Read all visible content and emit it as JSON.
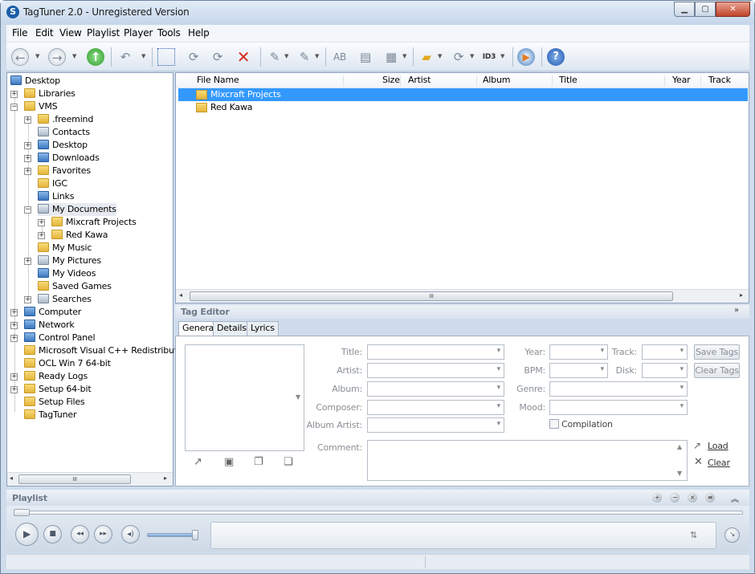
{
  "window": {
    "title": "TagTuner 2.0 - Unregistered Version",
    "app_icon": "S"
  },
  "menu": [
    "File",
    "Edit",
    "View",
    "Playlist",
    "Player",
    "Tools",
    "Help"
  ],
  "tree": [
    {
      "label": "Desktop",
      "icon": "desktop-icon"
    },
    {
      "label": "Libraries",
      "icon": "libraries-icon"
    },
    {
      "label": "VMS",
      "icon": "user-folder-icon"
    },
    {
      "label": ".freemind",
      "icon": "folder-icon"
    },
    {
      "label": "Contacts",
      "icon": "contacts-icon"
    },
    {
      "label": "Desktop",
      "icon": "desktop-folder-icon"
    },
    {
      "label": "Downloads",
      "icon": "downloads-icon"
    },
    {
      "label": "Favorites",
      "icon": "favorites-icon"
    },
    {
      "label": "IGC",
      "icon": "folder-icon"
    },
    {
      "label": "Links",
      "icon": "links-icon"
    },
    {
      "label": "My Documents",
      "icon": "documents-icon"
    },
    {
      "label": "Mixcraft Projects",
      "icon": "folder-icon"
    },
    {
      "label": "Red Kawa",
      "icon": "folder-icon"
    },
    {
      "label": "My Music",
      "icon": "music-icon"
    },
    {
      "label": "My Pictures",
      "icon": "pictures-icon"
    },
    {
      "label": "My Videos",
      "icon": "videos-icon"
    },
    {
      "label": "Saved Games",
      "icon": "saved-games-icon"
    },
    {
      "label": "Searches",
      "icon": "searches-icon"
    },
    {
      "label": "Computer",
      "icon": "computer-icon"
    },
    {
      "label": "Network",
      "icon": "network-icon"
    },
    {
      "label": "Control Panel",
      "icon": "control-panel-icon"
    },
    {
      "label": "Microsoft Visual C++ Redistributable",
      "icon": "folder-icon"
    },
    {
      "label": "OCL Win 7 64-bit",
      "icon": "folder-icon"
    },
    {
      "label": "Ready Logs",
      "icon": "folder-icon"
    },
    {
      "label": "Setup 64-bit",
      "icon": "folder-icon"
    },
    {
      "label": "Setup Files",
      "icon": "folder-icon"
    },
    {
      "label": "TagTuner",
      "icon": "folder-icon"
    }
  ],
  "file_list": {
    "columns": [
      "File Name",
      "Size",
      "Artist",
      "Album",
      "Title",
      "Year",
      "Track"
    ],
    "rows": [
      {
        "name": "Mixcraft Projects",
        "selected": true
      },
      {
        "name": "Red Kawa",
        "selected": false
      }
    ],
    "selection_color": "#3399ff"
  },
  "scroll_grip": "III",
  "tag_editor": {
    "title": "Tag Editor",
    "tabs": [
      "General",
      "Details",
      "Lyrics"
    ],
    "active_tab": "General",
    "labels": {
      "title": "Title:",
      "artist": "Artist:",
      "album": "Album:",
      "composer": "Composer:",
      "album_artist": "Album Artist:",
      "comment": "Comment:",
      "year": "Year:",
      "bpm": "BPM:",
      "genre": "Genre:",
      "mood": "Mood:",
      "track": "Track:",
      "disk": "Disk:"
    },
    "compilation": "Compilation",
    "save_tags": "Save Tags",
    "clear_tags": "Clear Tags",
    "load": "Load",
    "clear": "Clear"
  },
  "playlist": {
    "title": "Playlist"
  }
}
